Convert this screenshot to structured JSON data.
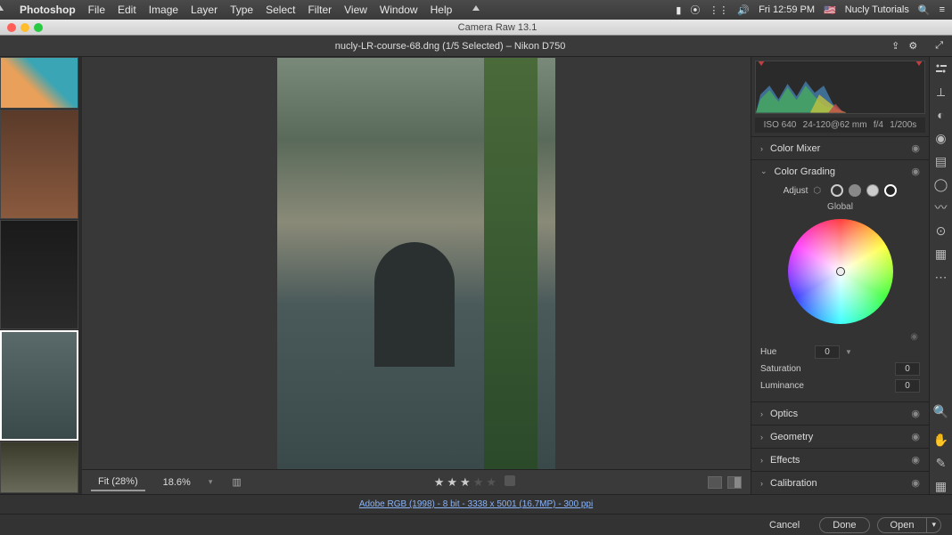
{
  "menubar": {
    "app": "Photoshop",
    "items": [
      "File",
      "Edit",
      "Image",
      "Layer",
      "Type",
      "Select",
      "Filter",
      "View",
      "Window",
      "Help"
    ],
    "clock": "Fri 12:59 PM",
    "user": "Nucly Tutorials",
    "flag": "🇺🇸"
  },
  "window": {
    "title": "Camera Raw 13.1"
  },
  "docbar": {
    "filename": "nucly-LR-course-68.dng (1/5 Selected)  –  Nikon D750"
  },
  "zoom": {
    "fit": "Fit (28%)",
    "pct": "18.6%"
  },
  "meta": {
    "iso": "ISO 640",
    "lens": "24-120@62 mm",
    "aperture": "f/4",
    "shutter": "1/200s"
  },
  "panels": {
    "colorMixer": "Color Mixer",
    "colorGrading": {
      "title": "Color Grading",
      "adjust_label": "Adjust",
      "global": "Global",
      "sliders": {
        "hue": {
          "label": "Hue",
          "value": "0",
          "pos": 0
        },
        "sat": {
          "label": "Saturation",
          "value": "0",
          "pos": 0
        },
        "lum": {
          "label": "Luminance",
          "value": "0",
          "pos": 50
        }
      }
    },
    "optics": "Optics",
    "geometry": "Geometry",
    "effects": "Effects",
    "calibration": "Calibration"
  },
  "footer": {
    "profile": "Adobe RGB (1998) - 8 bit - 3338 x 5001 (16.7MP) - 300 ppi",
    "cancel": "Cancel",
    "done": "Done",
    "open": "Open"
  },
  "tools": [
    "edit",
    "crop",
    "heal",
    "eye",
    "grad",
    "radial",
    "brush",
    "snapshot",
    "preset",
    "more"
  ],
  "tools_bottom": [
    "zoom",
    "hand",
    "sampler",
    "grid"
  ]
}
